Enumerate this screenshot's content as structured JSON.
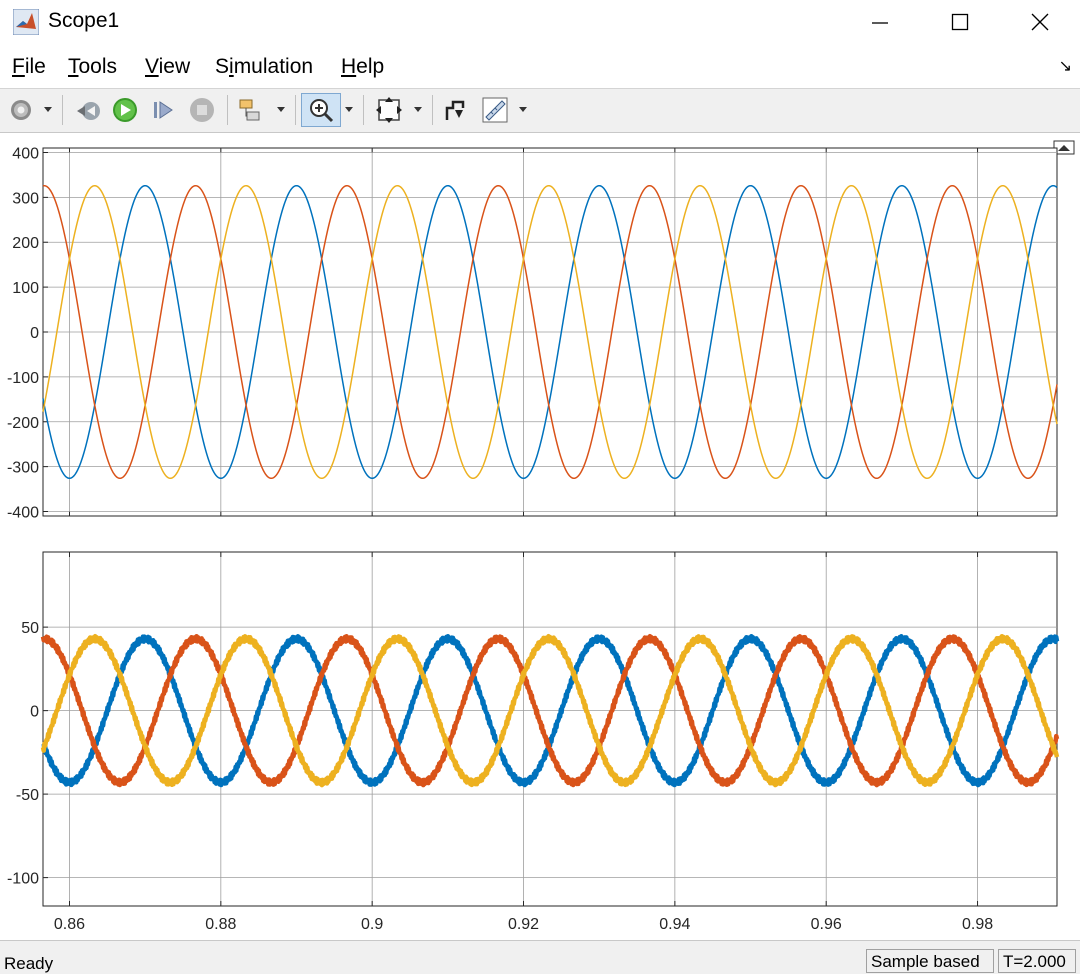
{
  "window": {
    "title": "Scope1"
  },
  "menu": {
    "items": [
      {
        "label": "File",
        "accel": "F",
        "rest": "ile"
      },
      {
        "label": "Tools",
        "accel": "T",
        "rest": "ools"
      },
      {
        "label": "View",
        "accel": "V",
        "rest": "iew"
      },
      {
        "label": "Simulation",
        "accel": "i",
        "pre": "S",
        "rest": "mulation"
      },
      {
        "label": "Help",
        "accel": "H",
        "rest": "elp"
      }
    ]
  },
  "toolbar": {
    "icons": [
      "settings-icon",
      "step-back-icon",
      "run-icon",
      "step-forward-icon",
      "stop-icon",
      "highlight-block-icon",
      "zoom-in-icon",
      "autoscale-icon",
      "write-data-icon",
      "measure-icon"
    ]
  },
  "status": {
    "ready": "Ready",
    "sample": "Sample based",
    "time": "T=2.000"
  },
  "colors": {
    "phase_a": "#0072BD",
    "phase_b": "#D95319",
    "phase_c": "#EDB120"
  },
  "chart_data": [
    {
      "type": "line",
      "title": "",
      "xlabel": "",
      "ylabel": "",
      "xlim": [
        0.8565,
        0.9905
      ],
      "ylim": [
        -410,
        410
      ],
      "yticks": [
        -400,
        -300,
        -200,
        -100,
        0,
        100,
        200,
        300,
        400
      ],
      "ytick_labels": [
        "-400",
        "-300",
        "-200",
        "-100",
        "0",
        "100",
        "200",
        "300",
        "400"
      ],
      "xticks": [
        0.86,
        0.88,
        0.9,
        0.92,
        0.94,
        0.96,
        0.98
      ],
      "grid": true,
      "frequency_hz": 50,
      "series": [
        {
          "amplitude": 326,
          "phase_deg": -90,
          "color": "#0072BD"
        },
        {
          "amplitude": 326,
          "phase_deg": 150,
          "color": "#D95319"
        },
        {
          "amplitude": 326,
          "phase_deg": 30,
          "color": "#EDB120"
        }
      ]
    },
    {
      "type": "line",
      "title": "",
      "xlabel": "",
      "ylabel": "",
      "xlim": [
        0.8565,
        0.9905
      ],
      "ylim": [
        -117,
        95
      ],
      "yticks": [
        -100,
        -50,
        0,
        50
      ],
      "ytick_labels": [
        "-100",
        "-50",
        "0",
        "50"
      ],
      "xticks": [
        0.86,
        0.88,
        0.9,
        0.92,
        0.94,
        0.96,
        0.98
      ],
      "xtick_labels": [
        "0.86",
        "0.88",
        "0.9",
        "0.92",
        "0.94",
        "0.96",
        "0.98"
      ],
      "grid": true,
      "frequency_hz": 50,
      "series": [
        {
          "amplitude": 43,
          "phase_deg": -90,
          "color": "#0072BD"
        },
        {
          "amplitude": 43,
          "phase_deg": 150,
          "color": "#D95319"
        },
        {
          "amplitude": 43,
          "phase_deg": 30,
          "color": "#EDB120"
        }
      ]
    }
  ]
}
